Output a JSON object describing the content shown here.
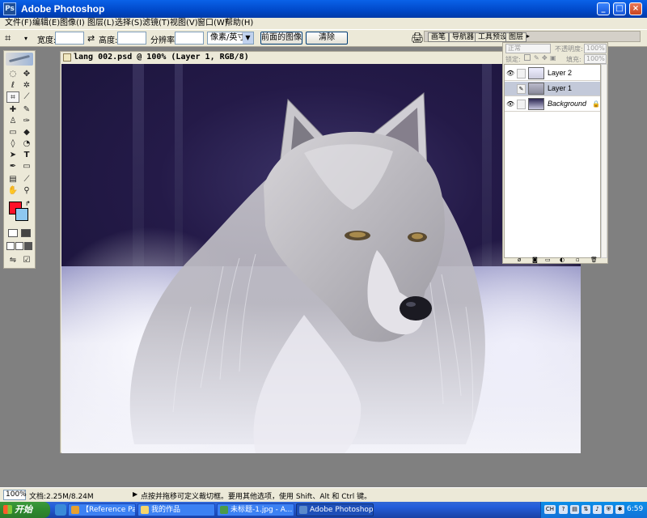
{
  "window": {
    "title": "Adobe Photoshop"
  },
  "menu": {
    "items": [
      "文件(F)",
      "编辑(E)",
      "图像(I)",
      "图层(L)",
      "选择(S)",
      "滤镜(T)",
      "视图(V)",
      "窗口(W)",
      "帮助(H)"
    ]
  },
  "options": {
    "width_label": "宽度:",
    "height_label": "高度:",
    "resolution_label": "分辨率:",
    "unit_value": "像素/英寸",
    "front_image_button": "前面的图像",
    "clear_button": "清除"
  },
  "palette_well": {
    "tabs": [
      "画笔",
      "导航器",
      "工具预设",
      "图层"
    ]
  },
  "document": {
    "title": "lang 002.psd @ 100% (Layer 1, RGB/8)"
  },
  "layers_panel": {
    "blend_mode": "正常",
    "opacity_label": "不透明度:",
    "opacity_value": "100%",
    "lock_label": "锁定:",
    "fill_label": "填充:",
    "fill_value": "100%",
    "layers": [
      {
        "name": "Layer 2",
        "visible": true,
        "selected": false
      },
      {
        "name": "Layer 1",
        "visible": false,
        "selected": true
      },
      {
        "name": "Background",
        "visible": true,
        "selected": false,
        "locked": true
      }
    ]
  },
  "status": {
    "zoom": "100%",
    "doc_size": "文档:2.25M/8.24M",
    "hint": "点按并拖移可定义裁切框。要用其他选项，使用 Shift、Alt 和 Ctrl 键。"
  },
  "taskbar": {
    "start_label": "开始",
    "tasks": [
      {
        "label": "【Reference Part...",
        "active": false
      },
      {
        "label": "我的作品",
        "active": false
      },
      {
        "label": "未标题-1.jpg - A...",
        "active": false
      },
      {
        "label": "Adobe Photoshop",
        "active": true
      }
    ],
    "tray_lang": "CH",
    "clock": "6:59"
  },
  "colors": {
    "foreground": "#ff1028",
    "background": "#8ec8f0",
    "titlebar": "#0a62e8"
  }
}
